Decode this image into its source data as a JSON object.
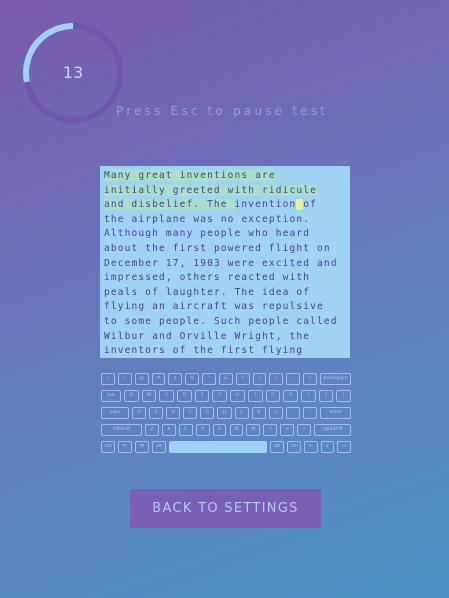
{
  "timer": {
    "value": "13",
    "progress_fraction": 0.28
  },
  "hint": "Press Esc to pause test",
  "passage": {
    "lines": [
      "Many great inventions are",
      "initially greeted with ridicule",
      "and disbelief. The invention of",
      "the airplane was no exception.",
      "Although many people who heard",
      "about the first powered flight on",
      "December 17, 1903 were excited and",
      "impressed, others reacted with",
      "peals of laughter. The idea of",
      "flying an aircraft was repulsive",
      "to some people. Such people called",
      "Wilbur and Orville Wright, the",
      "inventors of the first flying"
    ],
    "typed_chars": 81,
    "highlight_typed": "#a7e0c4",
    "highlight_cursor": "#f0eb9a"
  },
  "keyboard": {
    "rows": [
      [
        "~",
        "!",
        "@",
        "#",
        "$",
        "%",
        "^",
        "&",
        "*",
        "(",
        ")",
        "_",
        "+",
        "backspace"
      ],
      [
        "tab",
        "Q",
        "W",
        "E",
        "R",
        "T",
        "Y",
        "U",
        "I",
        "O",
        "P",
        "{",
        "}",
        "|"
      ],
      [
        "caps",
        "A",
        "S",
        "D",
        "F",
        "G",
        "H",
        "J",
        "K",
        "L",
        ":",
        "\"",
        "enter"
      ],
      [
        "leftShift",
        "Z",
        "X",
        "C",
        "V",
        "B",
        "N",
        "M",
        "<",
        ">",
        "?",
        "rightShift"
      ],
      [
        "ctrl",
        "fn",
        "⌘",
        "alt",
        "",
        "alt",
        "ctrl",
        "←",
        "↓",
        "→"
      ]
    ]
  },
  "back_button": "BACK TO SETTINGS",
  "colors": {
    "accent": "#9ed3f3",
    "text": "#4b3f91",
    "button": "#7a5fb7"
  }
}
